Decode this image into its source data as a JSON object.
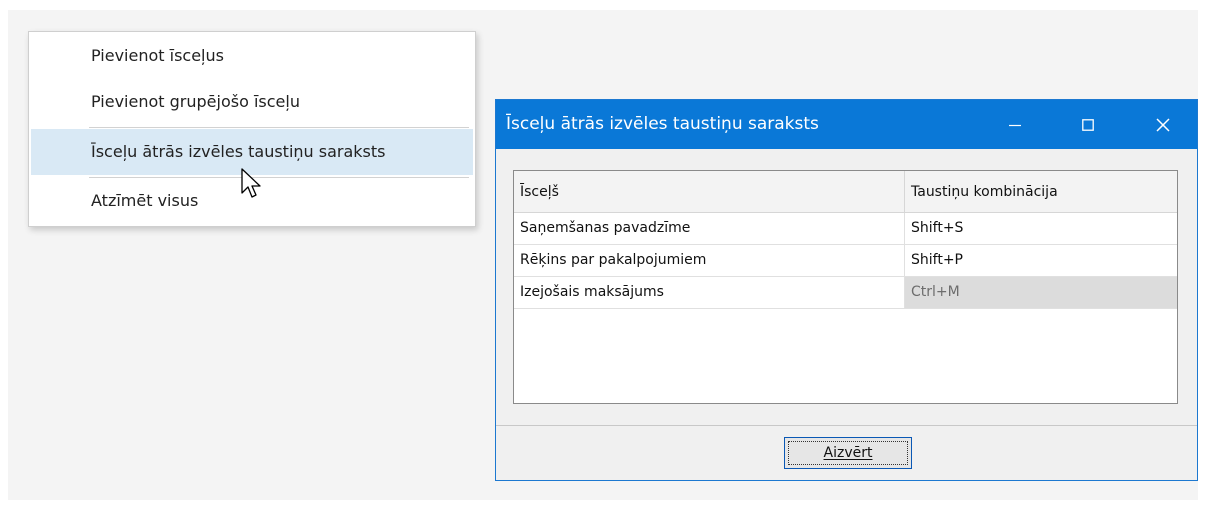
{
  "context_menu": {
    "items": [
      {
        "label": "Pievienot īsceļus"
      },
      {
        "label": "Pievienot grupējošo īsceļu"
      },
      {
        "label": "Īsceļu ātrās izvēles taustiņu saraksts",
        "hover": true
      },
      {
        "label": "Atzīmēt visus"
      }
    ]
  },
  "dialog": {
    "title": "Īsceļu ātrās izvēles taustiņu saraksts",
    "controls": {
      "minimize": "minimize-icon",
      "maximize": "maximize-icon",
      "close": "close-icon"
    },
    "columns": [
      "Īsceļš",
      "Taustiņu kombinācija"
    ],
    "rows": [
      {
        "shortcut": "Saņemšanas pavadzīme",
        "keys": "Shift+S"
      },
      {
        "shortcut": "Rēķins par pakalpojumiem",
        "keys": "Shift+P"
      },
      {
        "shortcut": "Izejošais maksājums",
        "keys": "Ctrl+M",
        "selected": true
      }
    ],
    "close_button": "Aizvērt"
  },
  "colors": {
    "titlebar": "#0a78d7",
    "menu_hover": "#d9e9f5",
    "selected_cell": "#dcdcdc"
  }
}
